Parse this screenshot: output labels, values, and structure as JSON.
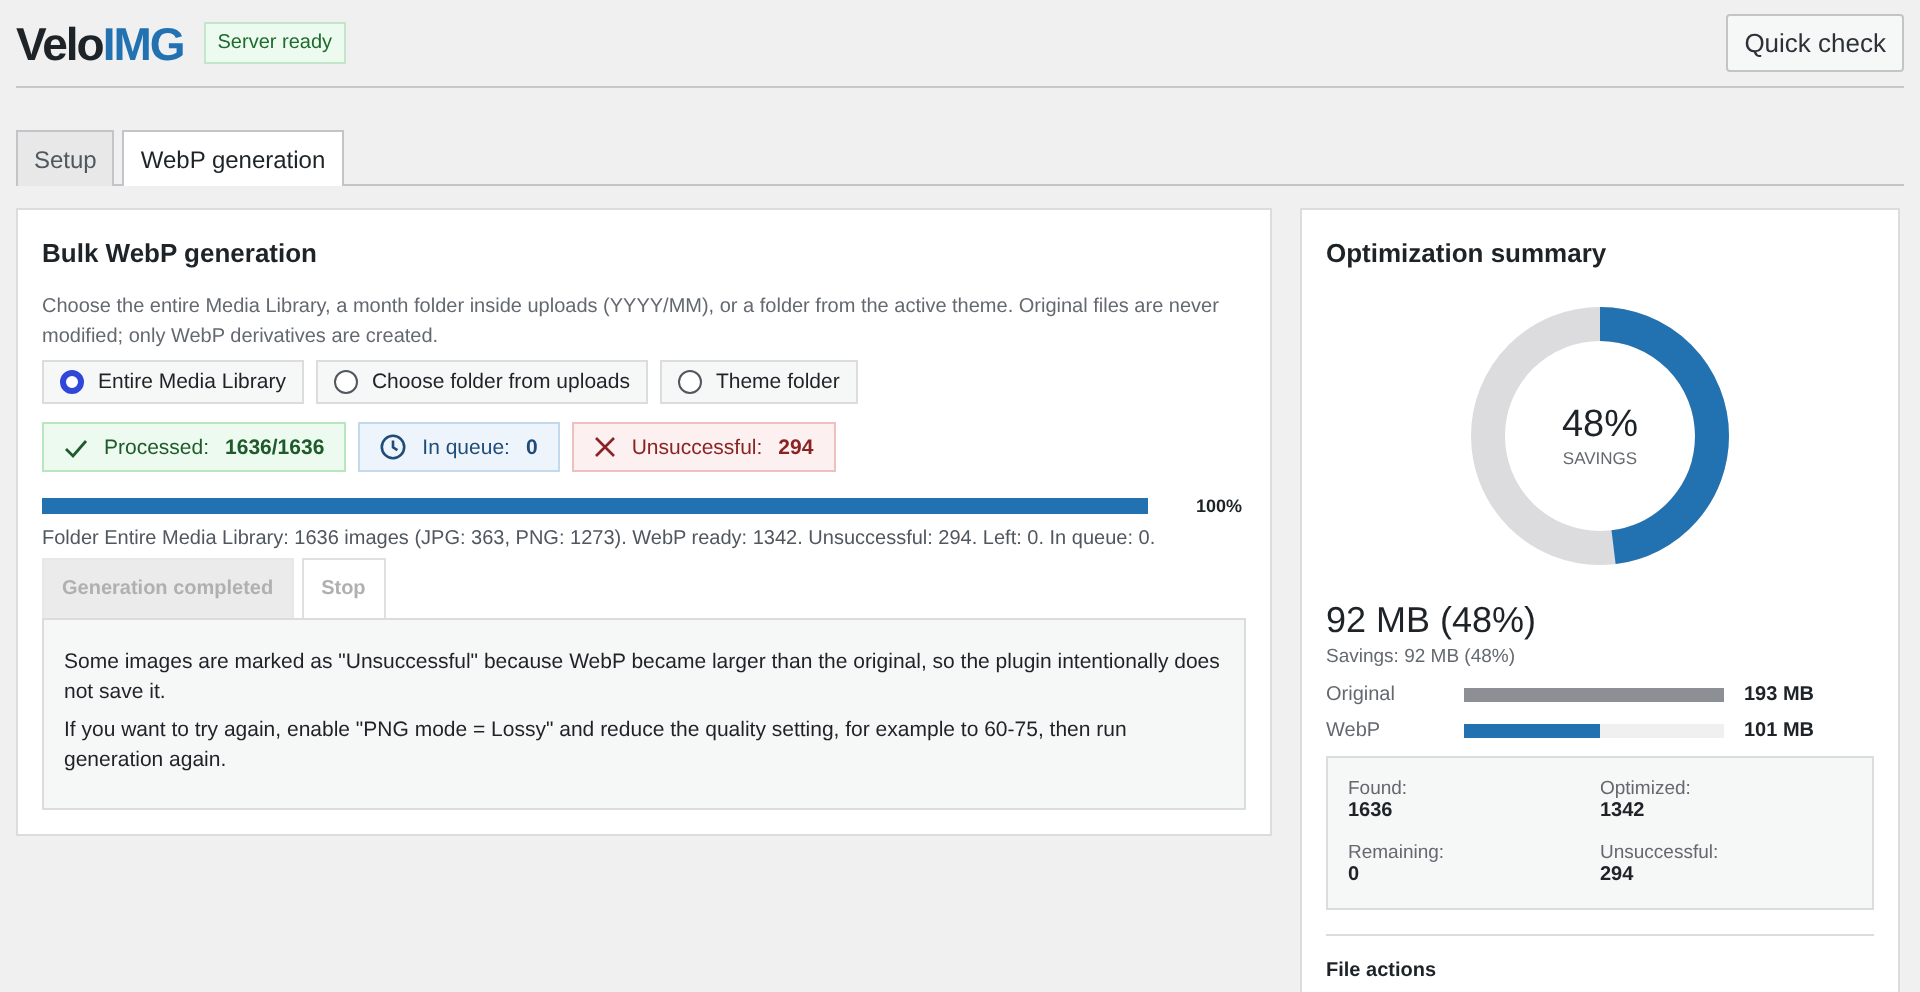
{
  "header": {
    "logo": {
      "part_1": "Velo",
      "part_2": "IMG"
    },
    "status_badge": "Server ready",
    "quick_check_button": "Quick check"
  },
  "tabs": [
    {
      "label": "Setup",
      "selected": false
    },
    {
      "label": "WebP generation",
      "selected": true
    }
  ],
  "bulk_panel": {
    "title": "Bulk WebP generation",
    "description": "Choose the entire Media Library, a month folder inside uploads (YYYY/MM), or a folder from the active theme. Original files are never modified; only WebP derivatives are created.",
    "sources": [
      {
        "label": "Entire Media Library",
        "selected": true
      },
      {
        "label": "Choose folder from uploads",
        "selected": false
      },
      {
        "label": "Theme folder",
        "selected": false
      }
    ],
    "stats": [
      {
        "kind": "processed",
        "label": "Processed:",
        "value": "1636/1636"
      },
      {
        "kind": "queue",
        "label": "In queue:",
        "value": "0"
      },
      {
        "kind": "failed",
        "label": "Unsuccessful:",
        "value": "294"
      }
    ],
    "progress": {
      "level": 1,
      "reading": "100%"
    },
    "status_line": "Folder Entire Media Library: 1636 images (JPG: 363, PNG: 1273). WebP ready: 1342. Unsuccessful: 294. Left: 0. In queue: 0.",
    "buttons": [
      {
        "label": "Generation completed",
        "disabled": true
      },
      {
        "label": "Stop",
        "disabled": false
      }
    ],
    "notes": [
      "Some images are marked as \"Unsuccessful\" because WebP became larger than the original, so the plugin intentionally does not save it.",
      "If you want to try again, enable \"PNG mode = Lossy\" and reduce the quality setting, for example to 60-75, then run generation again."
    ]
  },
  "summary_panel": {
    "title": "Optimization summary",
    "gauge": {
      "level": 0.48,
      "value": "48%",
      "caption": "SAVINGS"
    },
    "total": "92 MB (48%)",
    "subtitle": "Savings: 92 MB (48%)",
    "sizes": [
      {
        "label": "Original",
        "kind": "original",
        "level": 1,
        "reading": "193 MB"
      },
      {
        "label": "WebP",
        "kind": "webp",
        "level": 0.52,
        "reading": "101 MB"
      }
    ],
    "counts": [
      {
        "label": "Found:",
        "value": "1636"
      },
      {
        "label": "Optimized:",
        "value": "1342"
      },
      {
        "label": "Remaining:",
        "value": "0"
      },
      {
        "label": "Unsuccessful:",
        "value": "294"
      }
    ],
    "file_actions_title": "File actions"
  }
}
